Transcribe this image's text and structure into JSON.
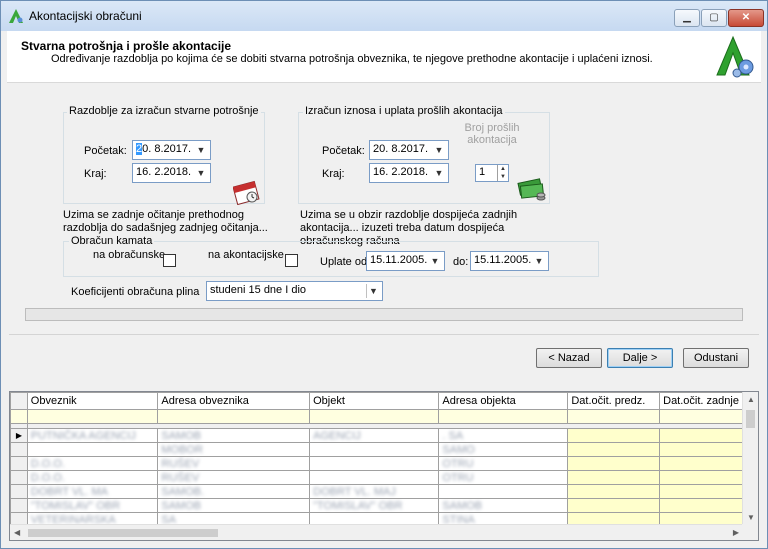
{
  "window": {
    "title": "Akontacijski obračuni"
  },
  "header": {
    "title": "Stvarna potrošnja i prošle akontacije",
    "subtitle": "Određivanje razdoblja po kojima će se dobiti stvarna potrošnja obveznika, te njegove prethodne akontacije i uplaćeni iznosi."
  },
  "left_group": {
    "title": "Razdoblje za izračun stvarne potrošnje",
    "start_label": "Početak:",
    "start_value": "20. 8.2017.",
    "end_label": "Kraj:",
    "end_value": "16. 2.2018.",
    "note": "Uzima se zadnje očitanje prethodnog razdoblja do sadašnjeg zadnjeg očitanja..."
  },
  "right_group": {
    "title": "Izračun iznosa i uplata prošlih akontacija",
    "start_label": "Početak:",
    "start_value": "20. 8.2017.",
    "end_label": "Kraj:",
    "end_value": "16. 2.2018.",
    "count_label_1": "Broj prošlih",
    "count_label_2": "akontacija",
    "count_value": "1",
    "note": "Uzima se u obzir razdoblje dospijeća zadnjih akontacija... izuzeti treba datum dospijeća obračunskog računa"
  },
  "interest_group": {
    "title": "Obračun kamata",
    "on_bills_label": "na obračunske",
    "on_advances_label": "na akontacijske",
    "payments_from_label": "Uplate od:",
    "payments_from_value": "15.11.2005.",
    "to_label": "do:",
    "to_value": "15.11.2005."
  },
  "coefficients": {
    "label": "Koeficijenti obračuna plina",
    "value": "studeni 15 dne I dio"
  },
  "buttons": {
    "back": "< Nazad",
    "next": "Dalje >",
    "cancel": "Odustani"
  },
  "grid": {
    "columns": [
      "Obveznik",
      "Adresa obveznika",
      "Objekt",
      "Adresa objekta",
      "Dat.očit. predz.",
      "Dat.očit. zadnje"
    ],
    "rows": [
      [
        "PUTNIČKA AGENCIJ",
        "SAMOB",
        "AGENCIJ",
        ". SA",
        "",
        ""
      ],
      [
        "",
        "MOBOR",
        "",
        "SAMO",
        "",
        ""
      ],
      [
        "D.O.O.",
        "RUŠEV",
        "",
        "OTRU",
        "",
        ""
      ],
      [
        "D.O.O.",
        "RUŠEV",
        "",
        "OTRU",
        "",
        ""
      ],
      [
        "DOBRT VL. MA",
        "SAMOB.",
        "DOBRT VL. MAJ",
        "",
        "",
        ""
      ],
      [
        "\"TOMISLAV\" OBR",
        "SAMOB",
        "\"TOMISLAV\" OBR",
        "SAMOB",
        "",
        ""
      ],
      [
        "VETERINARSKA",
        "SA",
        "",
        "STINA",
        "",
        ""
      ]
    ]
  }
}
